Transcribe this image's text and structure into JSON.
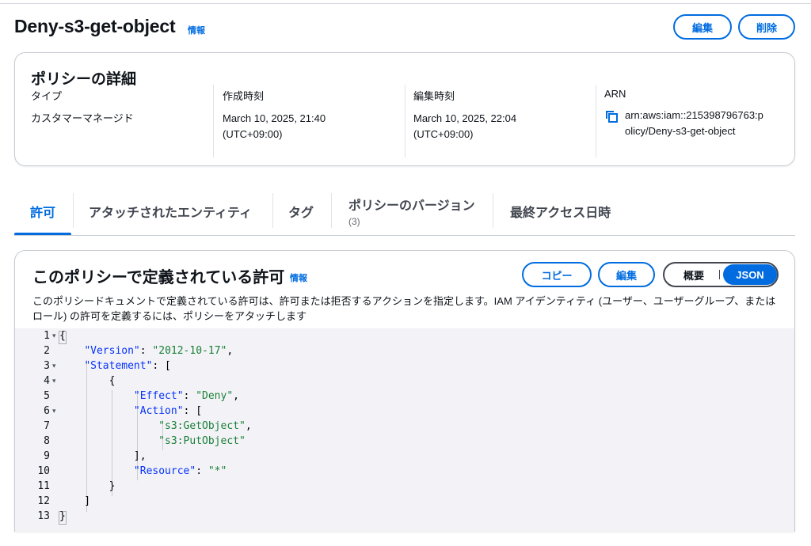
{
  "page": {
    "title": "Deny-s3-get-object",
    "info": "情報",
    "edit_button": "編集",
    "delete_button": "削除"
  },
  "details": {
    "heading": "ポリシーの詳細",
    "type": {
      "label": "タイプ",
      "value": "カスタマーマネージド"
    },
    "created": {
      "label": "作成時刻",
      "date": "March 10, 2025, 21:40",
      "tz": "(UTC+09:00)"
    },
    "edited": {
      "label": "編集時刻",
      "date": "March 10, 2025, 22:04",
      "tz": "(UTC+09:00)"
    },
    "arn": {
      "label": "ARN",
      "line1": "arn:aws:iam::215398796763:p",
      "line2": "olicy/Deny-s3-get-object",
      "icon": "copy-icon"
    }
  },
  "tabs": [
    {
      "label": "許可",
      "active": true
    },
    {
      "label": "アタッチされたエンティティ"
    },
    {
      "label": "タグ"
    },
    {
      "label": "ポリシーのバージョン",
      "count": "(3)"
    },
    {
      "label": "最終アクセス日時"
    }
  ],
  "permissions": {
    "heading": "このポリシーで定義されている許可",
    "info": "情報",
    "copy_button": "コピー",
    "edit_button": "編集",
    "view_overview": "概要",
    "view_json": "JSON",
    "description": "このポリシードキュメントで定義されている許可は、許可または拒否するアクションを指定します。IAM アイデンティティ (ユーザー、ユーザーグループ、またはロール) の許可を定義するには、ポリシーをアタッチします"
  },
  "code": {
    "line_numbers": [
      "1",
      "2",
      "3",
      "4",
      "5",
      "6",
      "7",
      "8",
      "9",
      "10",
      "11",
      "12",
      "13"
    ],
    "tokens": {
      "open_brace": "{",
      "version_key": "\"Version\"",
      "version_val": "\"2012-10-17\"",
      "statement_key": "\"Statement\"",
      "effect_key": "\"Effect\"",
      "effect_val": "\"Deny\"",
      "action_key": "\"Action\"",
      "action_1": "\"s3:GetObject\"",
      "action_2": "\"s3:PutObject\"",
      "resource_key": "\"Resource\"",
      "resource_val": "\"*\"",
      "close_brace": "}"
    }
  },
  "colors": {
    "accent": "#006ce0",
    "json_key": "#0431fa",
    "json_string": "#1a7f37",
    "editor_bg": "#f3f3f7"
  }
}
